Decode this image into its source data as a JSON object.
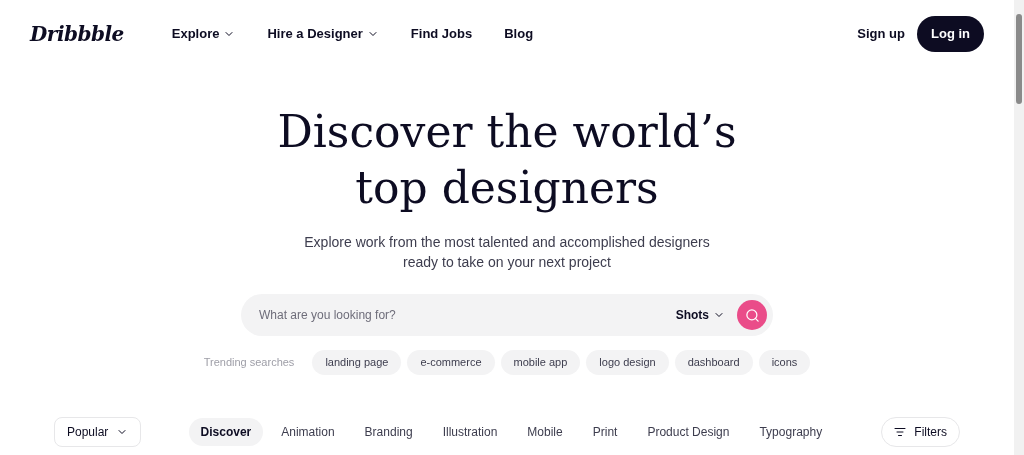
{
  "nav": {
    "logo": "Dribbble",
    "links": [
      {
        "label": "Explore",
        "dropdown": true
      },
      {
        "label": "Hire a Designer",
        "dropdown": true
      },
      {
        "label": "Find Jobs",
        "dropdown": false
      },
      {
        "label": "Blog",
        "dropdown": false
      }
    ],
    "signup": "Sign up",
    "login": "Log in"
  },
  "hero": {
    "title_lines": [
      "Discover the world’s",
      "top designers"
    ],
    "subtitle_lines": [
      "Explore work from the most talented and accomplished designers",
      "ready to take on your next project"
    ]
  },
  "search": {
    "placeholder": "What are you looking for?",
    "scope": "Shots"
  },
  "trending": {
    "label": "Trending searches",
    "tags": [
      "landing page",
      "e-commerce",
      "mobile app",
      "logo design",
      "dashboard",
      "icons"
    ]
  },
  "filter_bar": {
    "sort": "Popular",
    "categories": [
      {
        "label": "Discover",
        "selected": true
      },
      {
        "label": "Animation",
        "selected": false
      },
      {
        "label": "Branding",
        "selected": false
      },
      {
        "label": "Illustration",
        "selected": false
      },
      {
        "label": "Mobile",
        "selected": false
      },
      {
        "label": "Print",
        "selected": false
      },
      {
        "label": "Product Design",
        "selected": false
      },
      {
        "label": "Typography",
        "selected": false
      }
    ],
    "filters": "Filters"
  }
}
